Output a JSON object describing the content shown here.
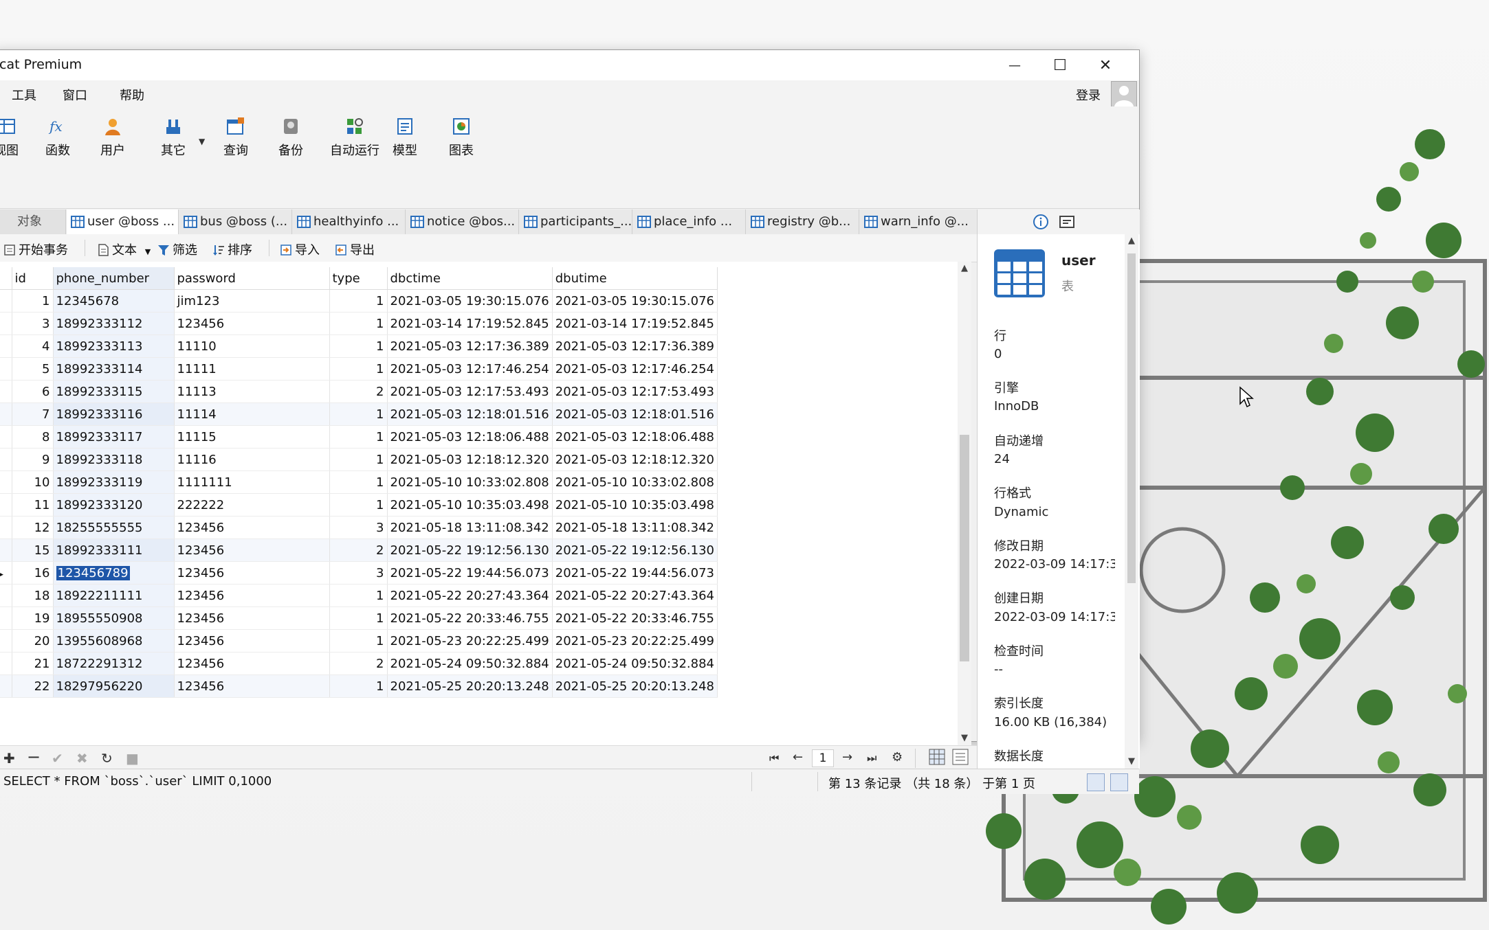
{
  "window": {
    "title": "cat Premium",
    "controls": {
      "minimize": "—",
      "maximize": "☐",
      "close": "✕"
    }
  },
  "menu": {
    "items": [
      "工具",
      "窗口",
      "帮助"
    ],
    "login": "登录"
  },
  "toolbar": {
    "buttons": [
      {
        "label": "视图",
        "icon": "view-icon"
      },
      {
        "label": "函数",
        "icon": "function-icon"
      },
      {
        "label": "用户",
        "icon": "user-icon"
      },
      {
        "label": "其它",
        "icon": "other-icon"
      },
      {
        "label": "查询",
        "icon": "query-icon"
      },
      {
        "label": "备份",
        "icon": "backup-icon"
      },
      {
        "label": "自动运行",
        "icon": "autorun-icon"
      },
      {
        "label": "模型",
        "icon": "model-icon"
      },
      {
        "label": "图表",
        "icon": "chart-icon"
      }
    ]
  },
  "tabs": {
    "objects": "对象",
    "items": [
      "user @boss ...",
      "bus @boss (...",
      "healthyinfo ...",
      "notice @bos...",
      "participants_...",
      "place_info ...",
      "registry @b...",
      "warn_info @..."
    ]
  },
  "subtoolbar": {
    "begin_transaction": "开始事务",
    "text": "文本",
    "filter": "筛选",
    "sort": "排序",
    "import": "导入",
    "export": "导出"
  },
  "grid": {
    "columns": [
      "id",
      "phone_number",
      "password",
      "type",
      "dbctime",
      "dbutime"
    ],
    "rows": [
      [
        "1",
        "12345678",
        "jim123",
        "1",
        "2021-03-05 19:30:15.076",
        "2021-03-05 19:30:15.076"
      ],
      [
        "3",
        "18992333112",
        "123456",
        "1",
        "2021-03-14 17:19:52.845",
        "2021-03-14 17:19:52.845"
      ],
      [
        "4",
        "18992333113",
        "11110",
        "1",
        "2021-05-03 12:17:36.389",
        "2021-05-03 12:17:36.389"
      ],
      [
        "5",
        "18992333114",
        "11111",
        "1",
        "2021-05-03 12:17:46.254",
        "2021-05-03 12:17:46.254"
      ],
      [
        "6",
        "18992333115",
        "11113",
        "2",
        "2021-05-03 12:17:53.493",
        "2021-05-03 12:17:53.493"
      ],
      [
        "7",
        "18992333116",
        "11114",
        "1",
        "2021-05-03 12:18:01.516",
        "2021-05-03 12:18:01.516"
      ],
      [
        "8",
        "18992333117",
        "11115",
        "1",
        "2021-05-03 12:18:06.488",
        "2021-05-03 12:18:06.488"
      ],
      [
        "9",
        "18992333118",
        "11116",
        "1",
        "2021-05-03 12:18:12.320",
        "2021-05-03 12:18:12.320"
      ],
      [
        "10",
        "18992333119",
        "1111111",
        "1",
        "2021-05-10 10:33:02.808",
        "2021-05-10 10:33:02.808"
      ],
      [
        "11",
        "18992333120",
        "222222",
        "1",
        "2021-05-10 10:35:03.498",
        "2021-05-10 10:35:03.498"
      ],
      [
        "12",
        "18255555555",
        "123456",
        "3",
        "2021-05-18 13:11:08.342",
        "2021-05-18 13:11:08.342"
      ],
      [
        "15",
        "18992333111",
        "123456",
        "2",
        "2021-05-22 19:12:56.130",
        "2021-05-22 19:12:56.130"
      ],
      [
        "16",
        "123456789",
        "123456",
        "3",
        "2021-05-22 19:44:56.073",
        "2021-05-22 19:44:56.073"
      ],
      [
        "18",
        "18922211111",
        "123456",
        "1",
        "2021-05-22 20:27:43.364",
        "2021-05-22 20:27:43.364"
      ],
      [
        "19",
        "18955550908",
        "123456",
        "1",
        "2021-05-22 20:33:46.755",
        "2021-05-22 20:33:46.755"
      ],
      [
        "20",
        "13955608968",
        "123456",
        "1",
        "2021-05-23 20:22:25.499",
        "2021-05-23 20:22:25.499"
      ],
      [
        "21",
        "18722291312",
        "123456",
        "2",
        "2021-05-24 09:50:32.884",
        "2021-05-24 09:50:32.884"
      ],
      [
        "22",
        "18297956220",
        "123456",
        "1",
        "2021-05-25 20:20:13.248",
        "2021-05-25 20:20:13.248"
      ]
    ],
    "selected_row_index": 12,
    "selected_column": "phone_number"
  },
  "pager": {
    "page": "1"
  },
  "status": {
    "sql": "SELECT * FROM `boss`.`user` LIMIT 0,1000",
    "record_info": "第 13 条记录 （共 18 条） 于第 1 页"
  },
  "info": {
    "name": "user",
    "type": "表",
    "fields": [
      {
        "label": "行",
        "value": "0"
      },
      {
        "label": "引擎",
        "value": "InnoDB"
      },
      {
        "label": "自动递增",
        "value": "24"
      },
      {
        "label": "行格式",
        "value": "Dynamic"
      },
      {
        "label": "修改日期",
        "value": "2022-03-09 14:17:3"
      },
      {
        "label": "创建日期",
        "value": "2022-03-09 14:17:3"
      },
      {
        "label": "检查时间",
        "value": "--"
      },
      {
        "label": "索引长度",
        "value": "16.00 KB (16,384)"
      },
      {
        "label": "数据长度",
        "value": ""
      }
    ]
  },
  "colors": {
    "selection": "#1e56a8",
    "accent_blue": "#2a6ebb"
  }
}
